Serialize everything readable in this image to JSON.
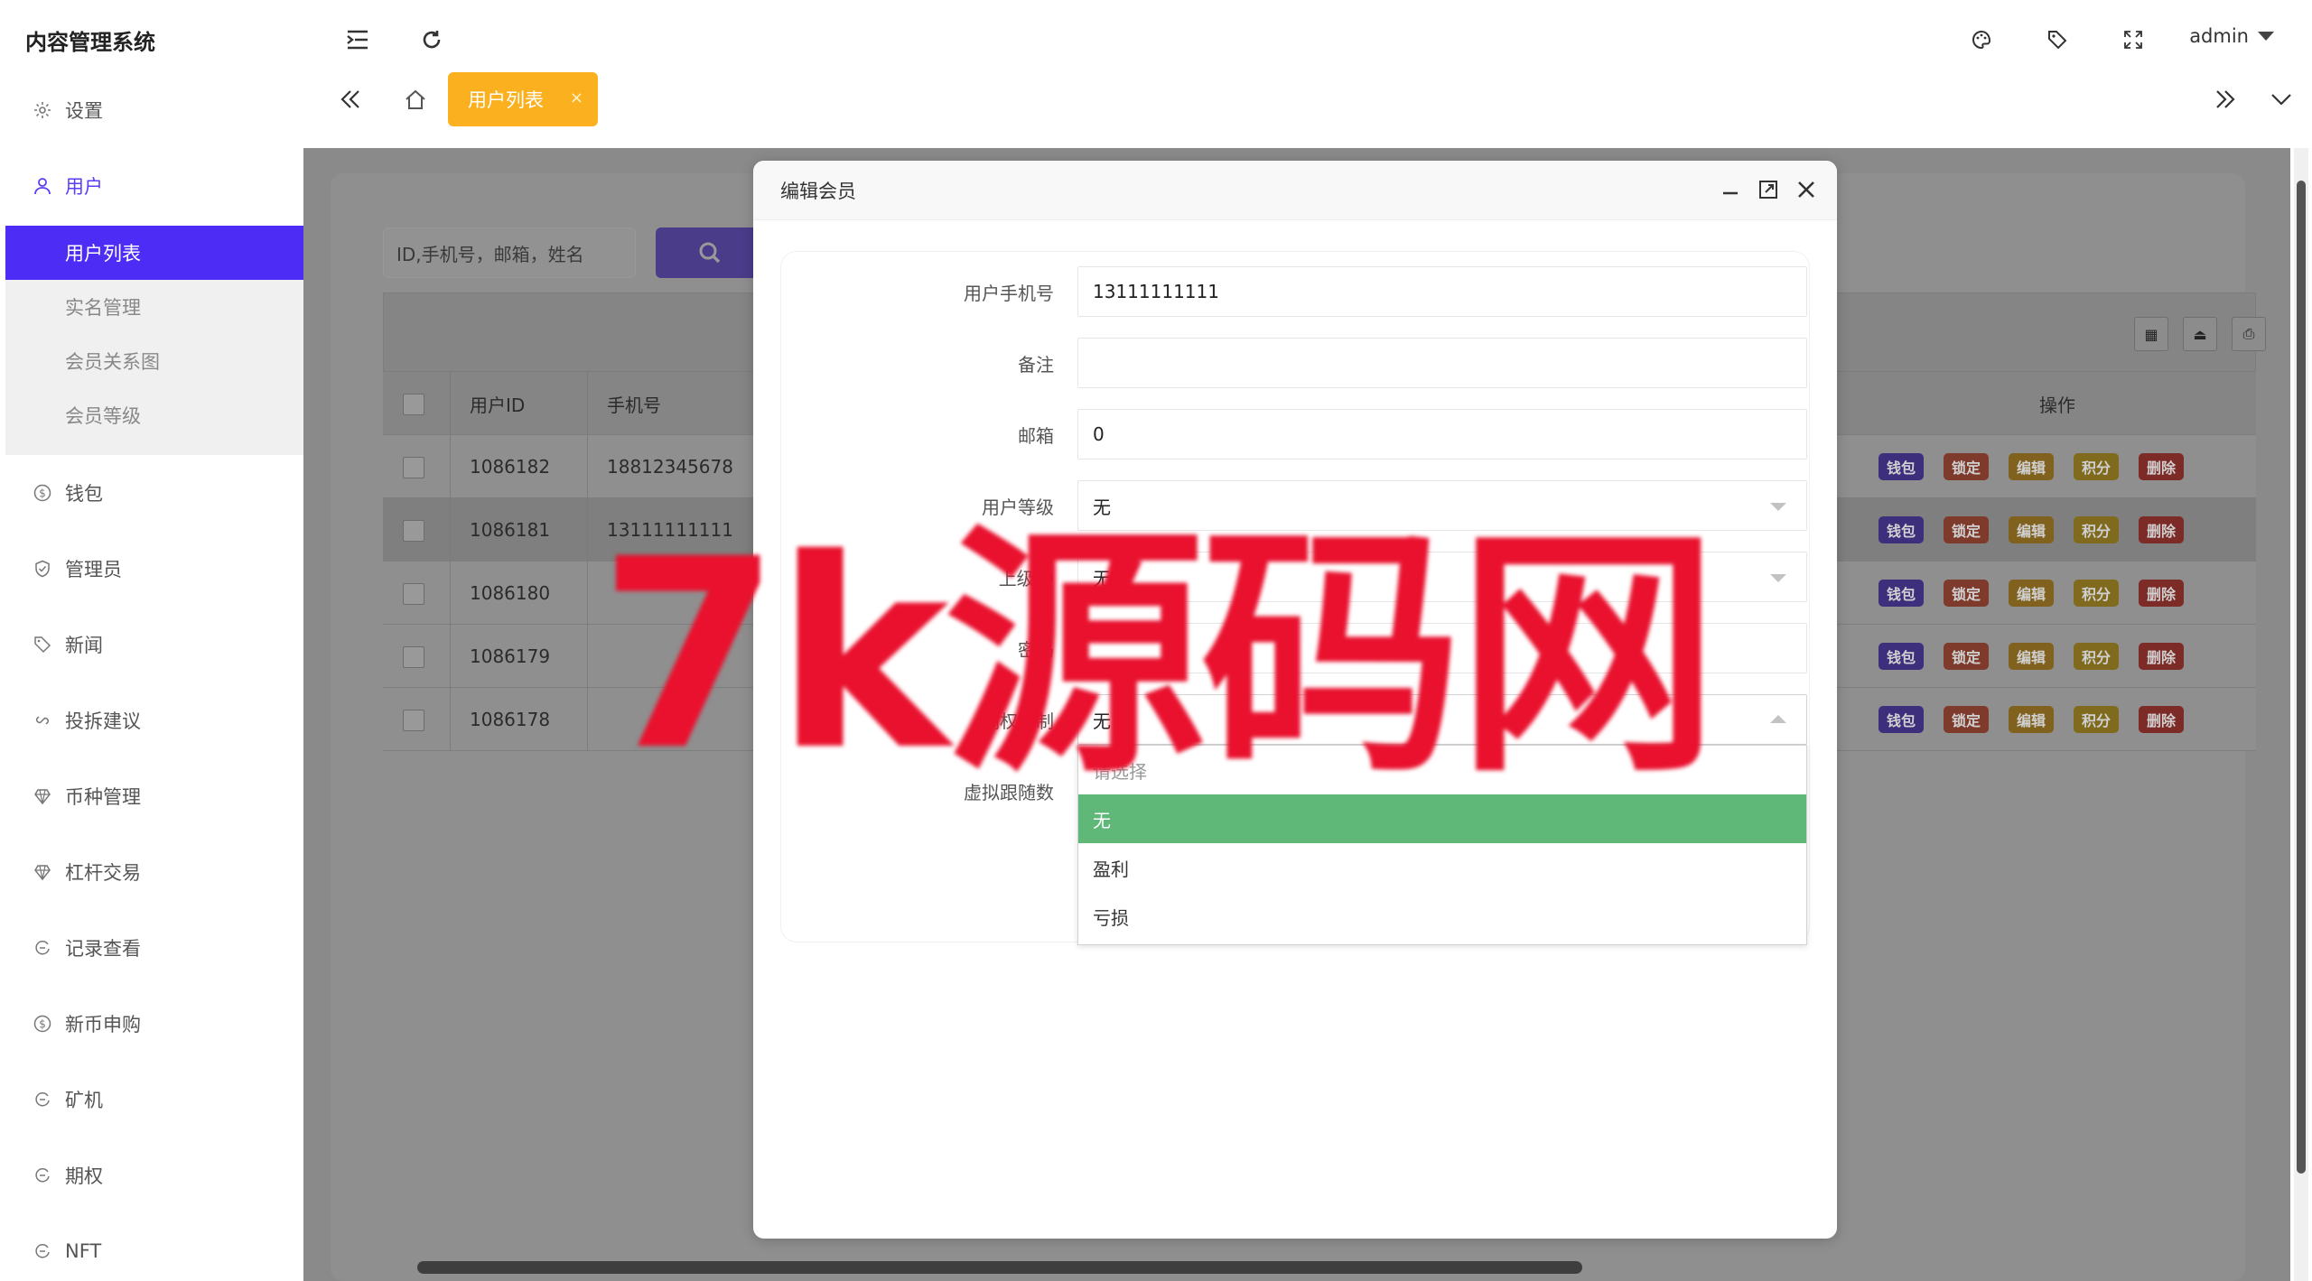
{
  "app": {
    "title": "内容管理系统"
  },
  "header": {
    "user": "admin"
  },
  "tabs": {
    "active_label": "用户列表",
    "close": "×"
  },
  "sidebar": {
    "items": [
      {
        "label": "设置",
        "icon": "gear-icon"
      },
      {
        "label": "用户",
        "icon": "user-icon",
        "active": true
      },
      {
        "label": "钱包",
        "icon": "dollar-icon"
      },
      {
        "label": "管理员",
        "icon": "shield-icon"
      },
      {
        "label": "新闻",
        "icon": "tag-icon"
      },
      {
        "label": "投拆建议",
        "icon": "link-icon"
      },
      {
        "label": "币种管理",
        "icon": "diamond-icon"
      },
      {
        "label": "杠杆交易",
        "icon": "diamond-icon"
      },
      {
        "label": "记录查看",
        "icon": "cycle-icon"
      },
      {
        "label": "新币申购",
        "icon": "dollar-icon"
      },
      {
        "label": "矿机",
        "icon": "cycle-icon"
      },
      {
        "label": "期权",
        "icon": "cycle-icon"
      },
      {
        "label": "NFT",
        "icon": "cycle-icon"
      }
    ],
    "sub_items": [
      {
        "label": "用户列表",
        "selected": true
      },
      {
        "label": "实名管理"
      },
      {
        "label": "会员关系图"
      },
      {
        "label": "会员等级"
      }
    ]
  },
  "search": {
    "placeholder": "ID,手机号，邮箱，姓名"
  },
  "table": {
    "headers": {
      "id": "用户ID",
      "phone": "手机号",
      "ops": "操作"
    },
    "rows": [
      {
        "id": "1086182",
        "phone": "18812345678"
      },
      {
        "id": "1086181",
        "phone": "13111111111"
      },
      {
        "id": "1086180",
        "phone": ""
      },
      {
        "id": "1086179",
        "phone": ""
      },
      {
        "id": "1086178",
        "phone": ""
      }
    ],
    "op_labels": {
      "wallet": "钱包",
      "lock": "锁定",
      "edit": "编辑",
      "score": "积分",
      "delete": "删除"
    }
  },
  "modal": {
    "title": "编辑会员",
    "fields": [
      {
        "label": "用户手机号",
        "value": "13111111111"
      },
      {
        "label": "备注",
        "value": ""
      },
      {
        "label": "邮箱",
        "value": "0"
      },
      {
        "label": "用户等级",
        "value": "无"
      },
      {
        "label": "上级ID",
        "value": "无"
      },
      {
        "label": "密码",
        "value": ""
      },
      {
        "label": "期权控制",
        "value": "无"
      },
      {
        "label": "虚拟跟随数",
        "value": ""
      }
    ],
    "dropdown": {
      "placeholder": "请选择",
      "options": [
        "无",
        "盈利",
        "亏损"
      ],
      "selected": "无"
    }
  },
  "watermark": "7k源码网",
  "colors": {
    "brand": "#4d2cf5",
    "tab_active": "#fbb01f",
    "option_selected": "#5fb878",
    "watermark": "#e9112e"
  }
}
